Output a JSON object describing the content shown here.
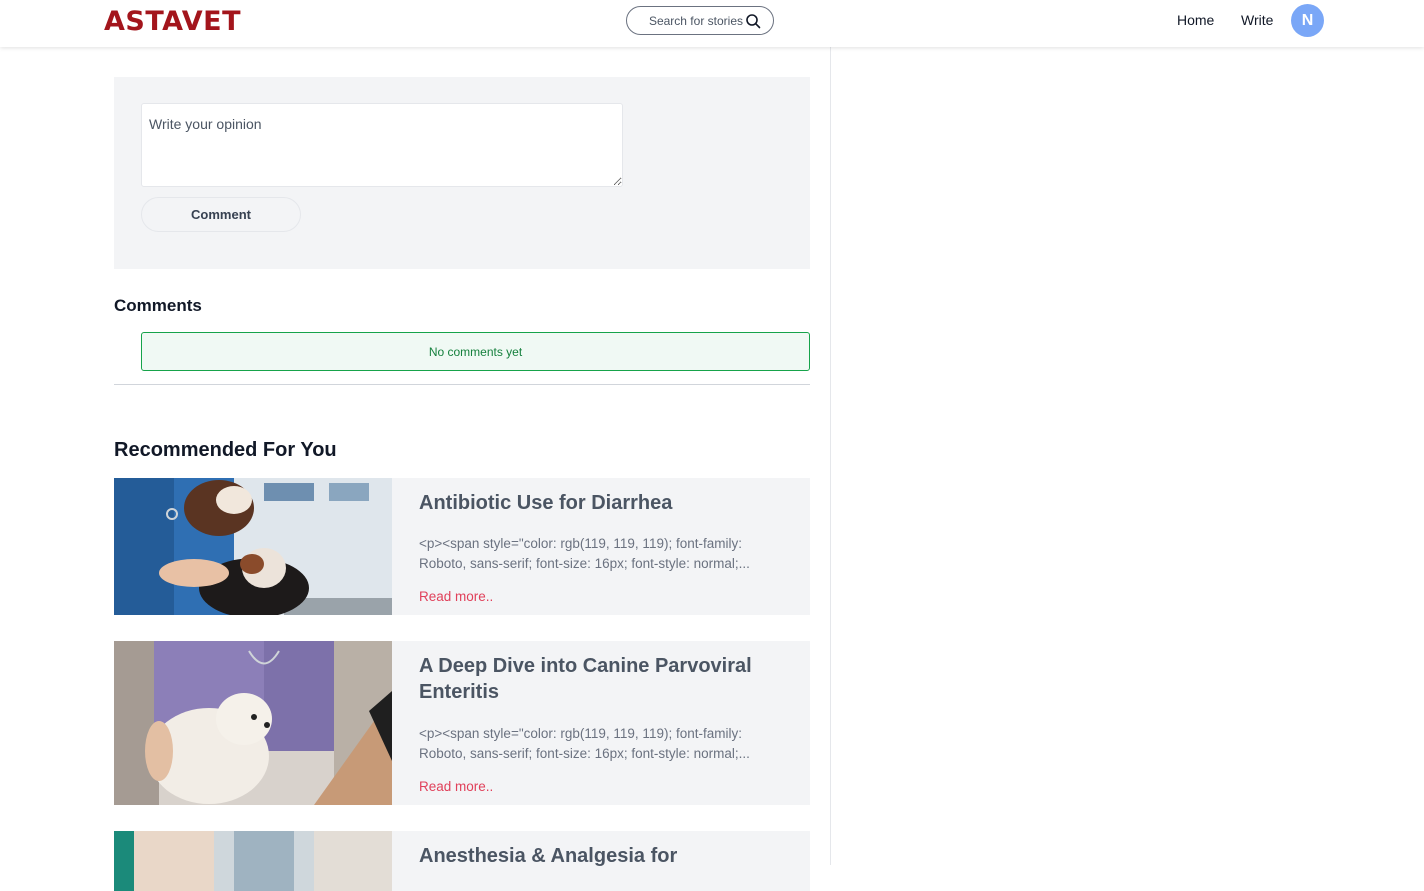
{
  "header": {
    "logo_text": "ASTAVET",
    "search_placeholder": "Search for stories",
    "nav_home": "Home",
    "nav_write": "Write",
    "avatar_initial": "N"
  },
  "comment_form": {
    "placeholder": "Write your opinion",
    "button_label": "Comment"
  },
  "comments": {
    "heading": "Comments",
    "empty_message": "No comments yet"
  },
  "recommended": {
    "heading": "Recommended For You",
    "read_more_label": "Read more..",
    "items": [
      {
        "title": "Antibiotic Use for Diarrhea",
        "excerpt": "<p><span style=\"color: rgb(119, 119, 119); font-family: Roboto, sans-serif; font-size: 16px; font-style: normal;...",
        "image": "vet-holding-puppies"
      },
      {
        "title": "A Deep Dive into Canine Parvoviral Enteritis",
        "excerpt": "<p><span style=\"color: rgb(119, 119, 119); font-family: Roboto, sans-serif; font-size: 16px; font-style: normal;...",
        "image": "vet-examining-white-dog"
      },
      {
        "title": "Anesthesia & Analgesia for",
        "excerpt": "",
        "image": "vet-clinic-teal"
      }
    ]
  },
  "colors": {
    "brand": "#a3151c",
    "avatar": "#7aa7f7",
    "read_more": "#e0405a",
    "success_border": "#16a34a",
    "panel_bg": "#f3f4f6"
  }
}
